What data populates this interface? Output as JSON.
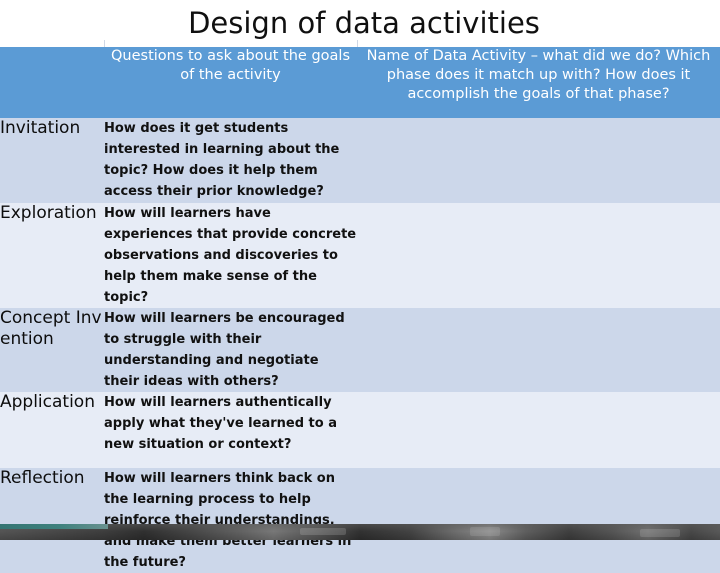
{
  "slide": {
    "title": "Design of data activities",
    "background_color": "#ffffff"
  },
  "table": {
    "header_bg": "#5b9bd5",
    "header_text_color": "#ffffff",
    "row_dark_bg": "#ccd7ea",
    "row_light_bg": "#e7ecf6",
    "gridline_color": "#ffffff",
    "columns": [
      {
        "key": "phase",
        "header": ""
      },
      {
        "key": "question",
        "header": "Questions to ask about the goals of the activity"
      },
      {
        "key": "name",
        "header": "Name of Data Activity – what did we do? Which phase does it match up with? How does it accomplish the goals of that phase?"
      }
    ],
    "rows": [
      {
        "phase": "Invitation",
        "question": "How does it get students interested in learning about the topic? How does it help them access their prior knowledge?",
        "name": ""
      },
      {
        "phase": "Exploration",
        "question": "How will learners have experiences that provide concrete observations and discoveries to help them make sense of the topic?",
        "name": ""
      },
      {
        "phase": "Concept Invention",
        "question": "How will learners be encouraged to struggle with their understanding and negotiate their ideas with others?",
        "name": ""
      },
      {
        "phase": "Application",
        "question": "How will learners authentically apply what they've learned to a new situation or context?",
        "name": ""
      },
      {
        "phase": "Reflection",
        "question": "How will learners think back on the learning process to help reinforce their understandings, and make them better learners in the future?",
        "name": ""
      }
    ]
  },
  "footer": {
    "photo_strip_label": "decorative-photo-strip"
  }
}
